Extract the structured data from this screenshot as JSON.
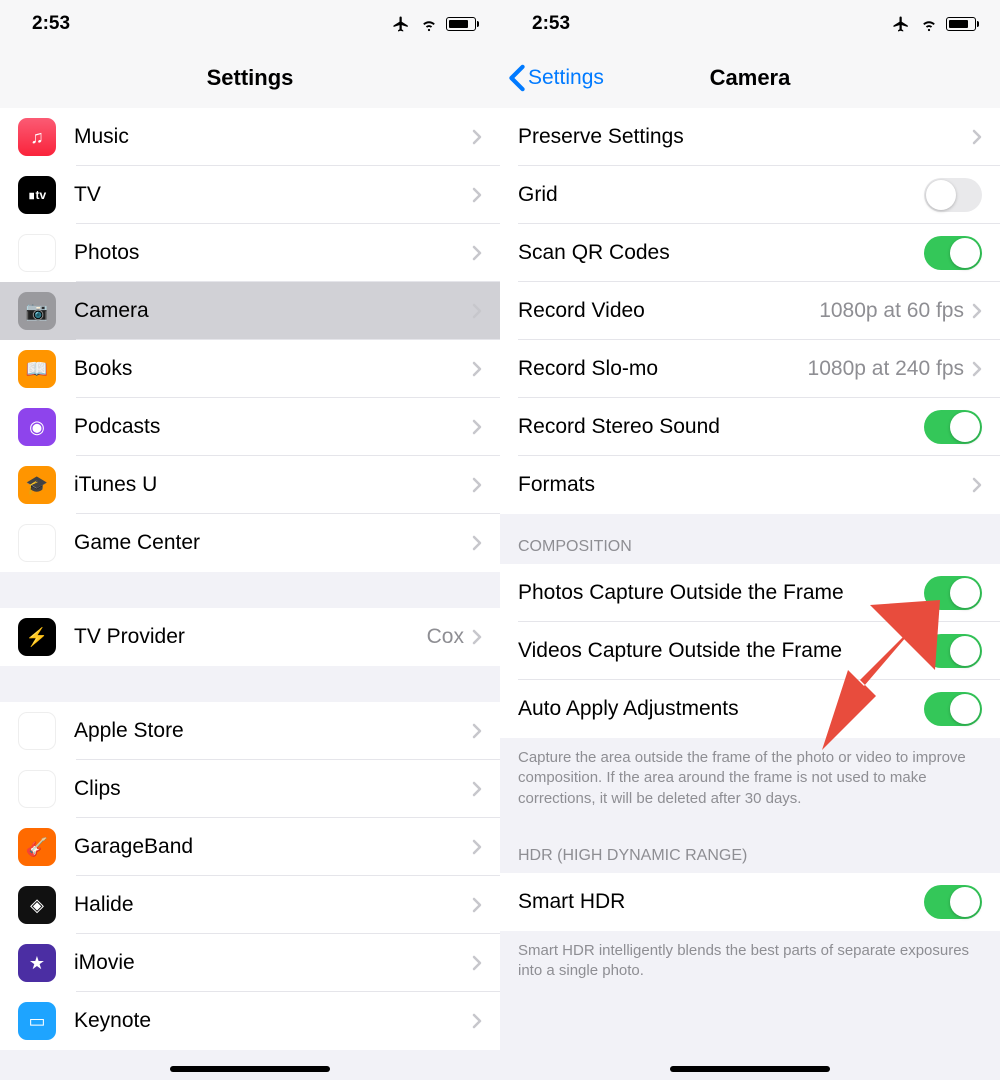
{
  "status": {
    "time": "2:53"
  },
  "left": {
    "title": "Settings",
    "groups": [
      {
        "items": [
          {
            "id": "music",
            "label": "Music",
            "icon": "music-icon"
          },
          {
            "id": "tv",
            "label": "TV",
            "icon": "tv-icon"
          },
          {
            "id": "photos",
            "label": "Photos",
            "icon": "photos-icon"
          },
          {
            "id": "camera",
            "label": "Camera",
            "icon": "camera-icon",
            "selected": true
          },
          {
            "id": "books",
            "label": "Books",
            "icon": "books-icon"
          },
          {
            "id": "podcasts",
            "label": "Podcasts",
            "icon": "podcasts-icon"
          },
          {
            "id": "itunesu",
            "label": "iTunes U",
            "icon": "itunesu-icon"
          },
          {
            "id": "gamecenter",
            "label": "Game Center",
            "icon": "gamecenter-icon"
          }
        ]
      },
      {
        "items": [
          {
            "id": "tvprovider",
            "label": "TV Provider",
            "icon": "tvprovider-icon",
            "value": "Cox"
          }
        ]
      },
      {
        "items": [
          {
            "id": "applestore",
            "label": "Apple Store",
            "icon": "applestore-icon"
          },
          {
            "id": "clips",
            "label": "Clips",
            "icon": "clips-icon"
          },
          {
            "id": "garageband",
            "label": "GarageBand",
            "icon": "garageband-icon"
          },
          {
            "id": "halide",
            "label": "Halide",
            "icon": "halide-icon"
          },
          {
            "id": "imovie",
            "label": "iMovie",
            "icon": "imovie-icon"
          },
          {
            "id": "keynote",
            "label": "Keynote",
            "icon": "keynote-icon"
          }
        ]
      }
    ]
  },
  "right": {
    "back_label": "Settings",
    "title": "Camera",
    "sections": [
      {
        "items": [
          {
            "id": "preserve",
            "label": "Preserve Settings",
            "type": "nav"
          },
          {
            "id": "grid",
            "label": "Grid",
            "type": "toggle",
            "on": false
          },
          {
            "id": "scanqr",
            "label": "Scan QR Codes",
            "type": "toggle",
            "on": true
          },
          {
            "id": "recvideo",
            "label": "Record Video",
            "type": "nav",
            "value": "1080p at 60 fps"
          },
          {
            "id": "recslomo",
            "label": "Record Slo-mo",
            "type": "nav",
            "value": "1080p at 240 fps"
          },
          {
            "id": "stereo",
            "label": "Record Stereo Sound",
            "type": "toggle",
            "on": true
          },
          {
            "id": "formats",
            "label": "Formats",
            "type": "nav"
          }
        ]
      },
      {
        "header": "COMPOSITION",
        "items": [
          {
            "id": "photosoutside",
            "label": "Photos Capture Outside the Frame",
            "type": "toggle",
            "on": true
          },
          {
            "id": "videosoutside",
            "label": "Videos Capture Outside the Frame",
            "type": "toggle",
            "on": true
          },
          {
            "id": "autoadjust",
            "label": "Auto Apply Adjustments",
            "type": "toggle",
            "on": true
          }
        ],
        "footer": "Capture the area outside the frame of the photo or video to improve composition. If the area around the frame is not used to make corrections, it will be deleted after 30 days."
      },
      {
        "header": "HDR (HIGH DYNAMIC RANGE)",
        "items": [
          {
            "id": "smarthdr",
            "label": "Smart HDR",
            "type": "toggle",
            "on": true
          }
        ],
        "footer": "Smart HDR intelligently blends the best parts of separate exposures into a single photo."
      }
    ]
  },
  "icon_glyphs": {
    "music-icon": "♫",
    "tv-icon": "∎tv",
    "photos-icon": "✿",
    "camera-icon": "📷",
    "books-icon": "📖",
    "podcasts-icon": "◉",
    "itunesu-icon": "🎓",
    "gamecenter-icon": "●",
    "tvprovider-icon": "⚡",
    "applestore-icon": "",
    "clips-icon": "◯",
    "garageband-icon": "🎸",
    "halide-icon": "◈",
    "imovie-icon": "★",
    "keynote-icon": "▭"
  },
  "annotation": {
    "type": "arrow",
    "target": "photosoutside-toggle"
  }
}
